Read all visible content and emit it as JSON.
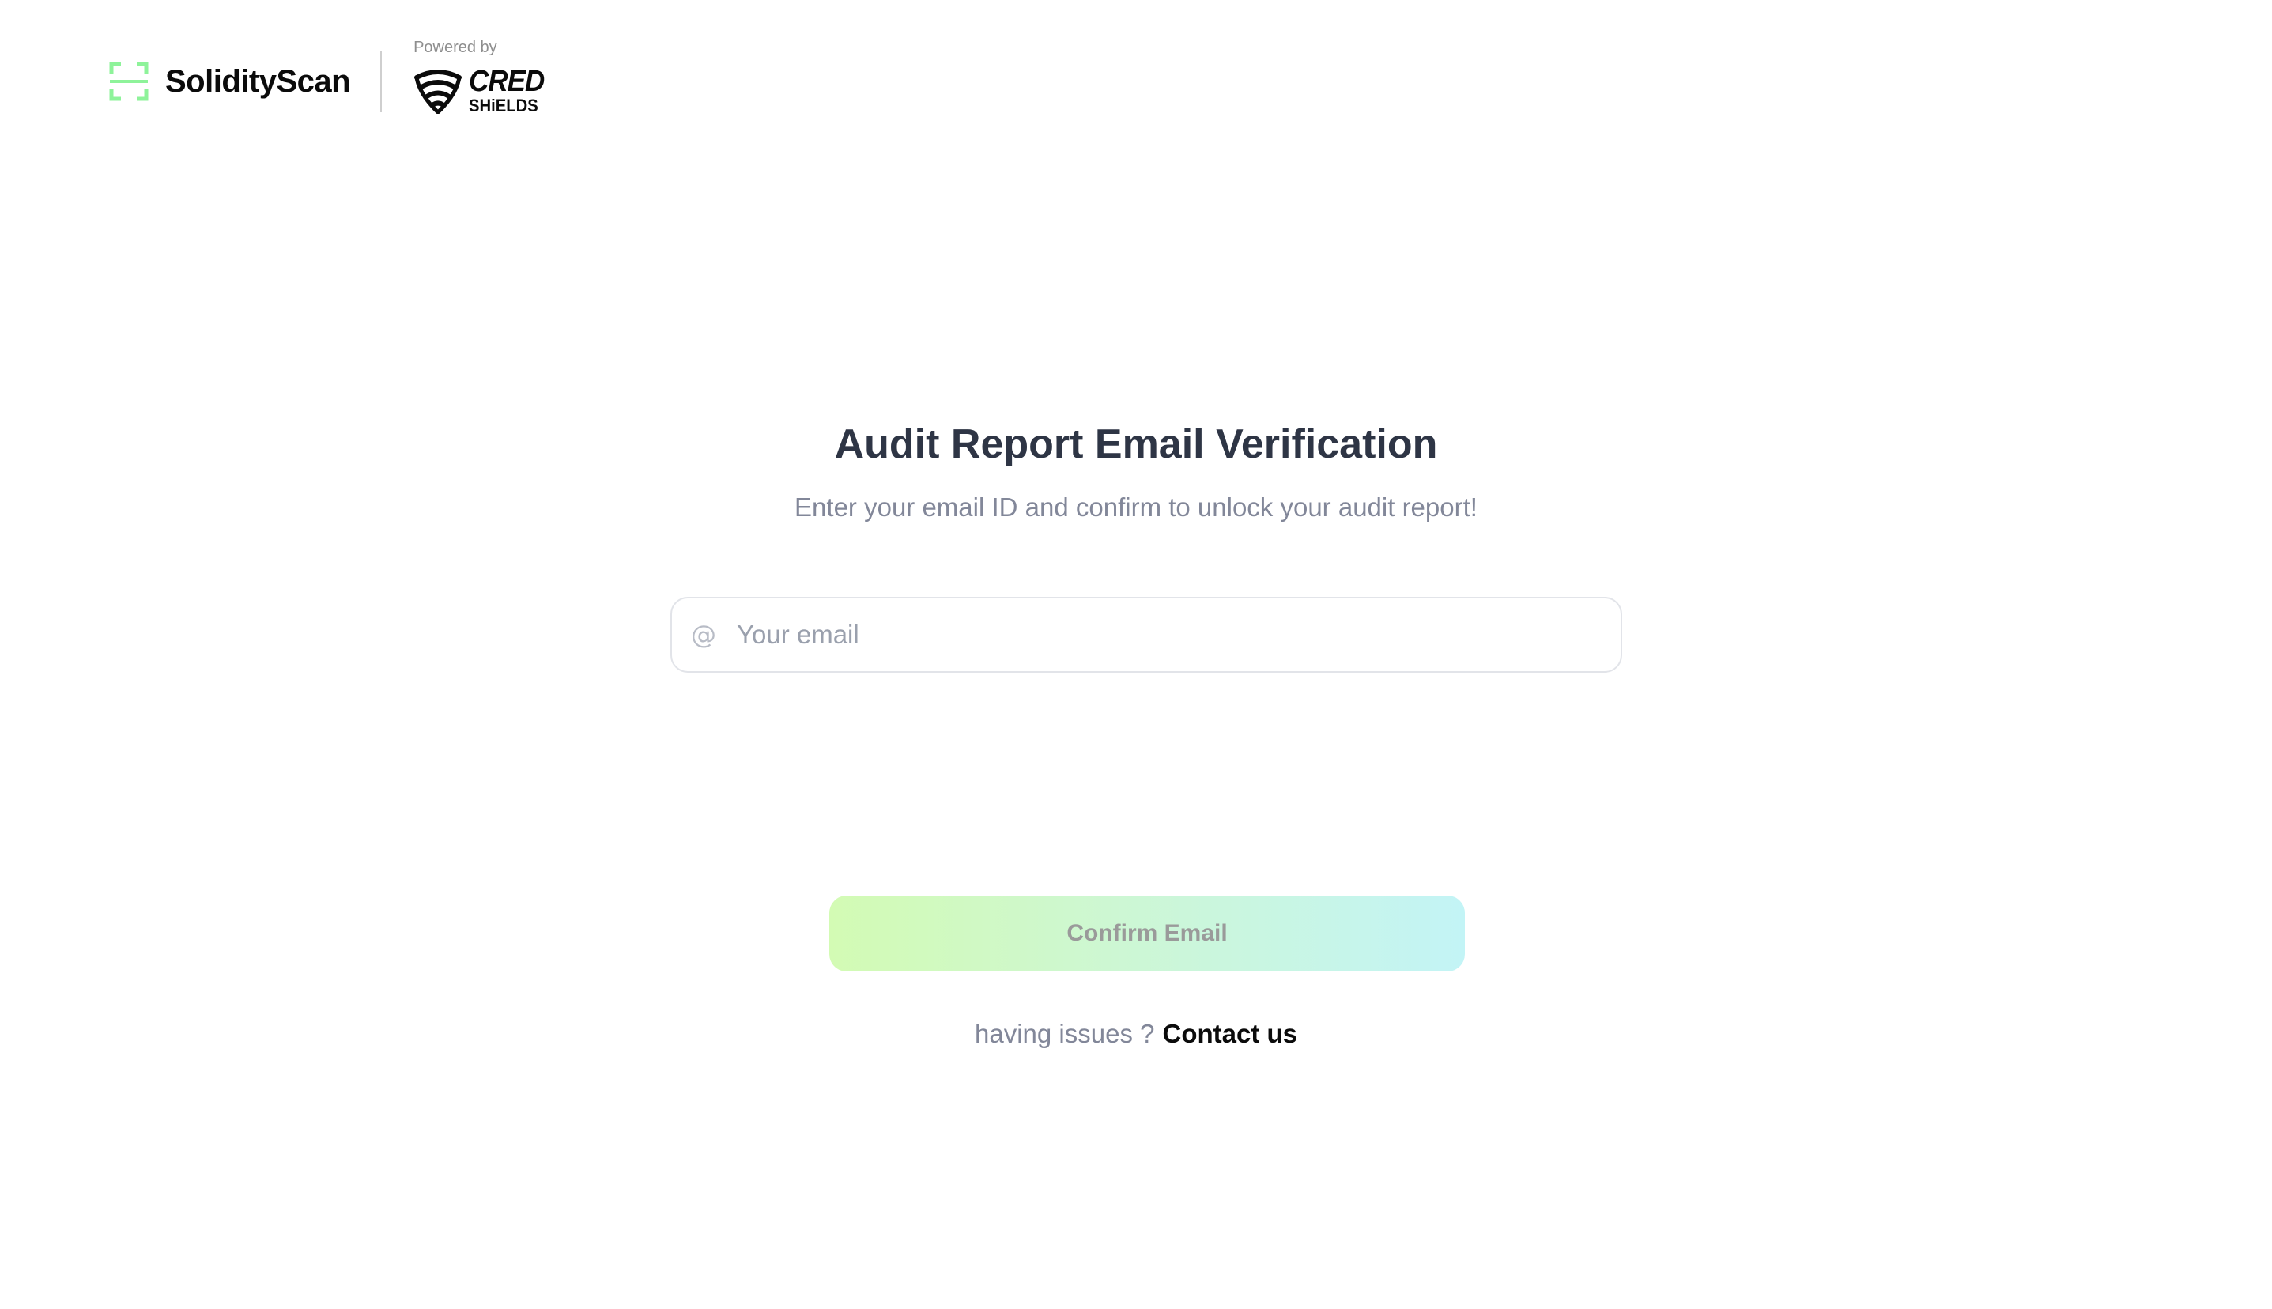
{
  "header": {
    "brand_name": "SolidityScan",
    "powered_by_label": "Powered by",
    "partner_logo_line1": "CRED",
    "partner_logo_line2": "SHiELDS"
  },
  "main": {
    "title": "Audit Report Email Verification",
    "subtitle": "Enter your email ID and confirm to unlock your audit report!",
    "email_field": {
      "icon": "at-icon",
      "icon_glyph": "@",
      "value": "",
      "placeholder": "Your email"
    },
    "confirm_button_label": "Confirm Email",
    "help_text": "having issues ?",
    "contact_link_label": "Contact us"
  },
  "colors": {
    "brand_green": "#8ef39a",
    "title_text": "#2e3545",
    "muted_text": "#828799",
    "button_gradient_start": "#d3fbb4",
    "button_gradient_end": "#c3f4f6",
    "button_text_disabled": "#9a9a9a"
  }
}
